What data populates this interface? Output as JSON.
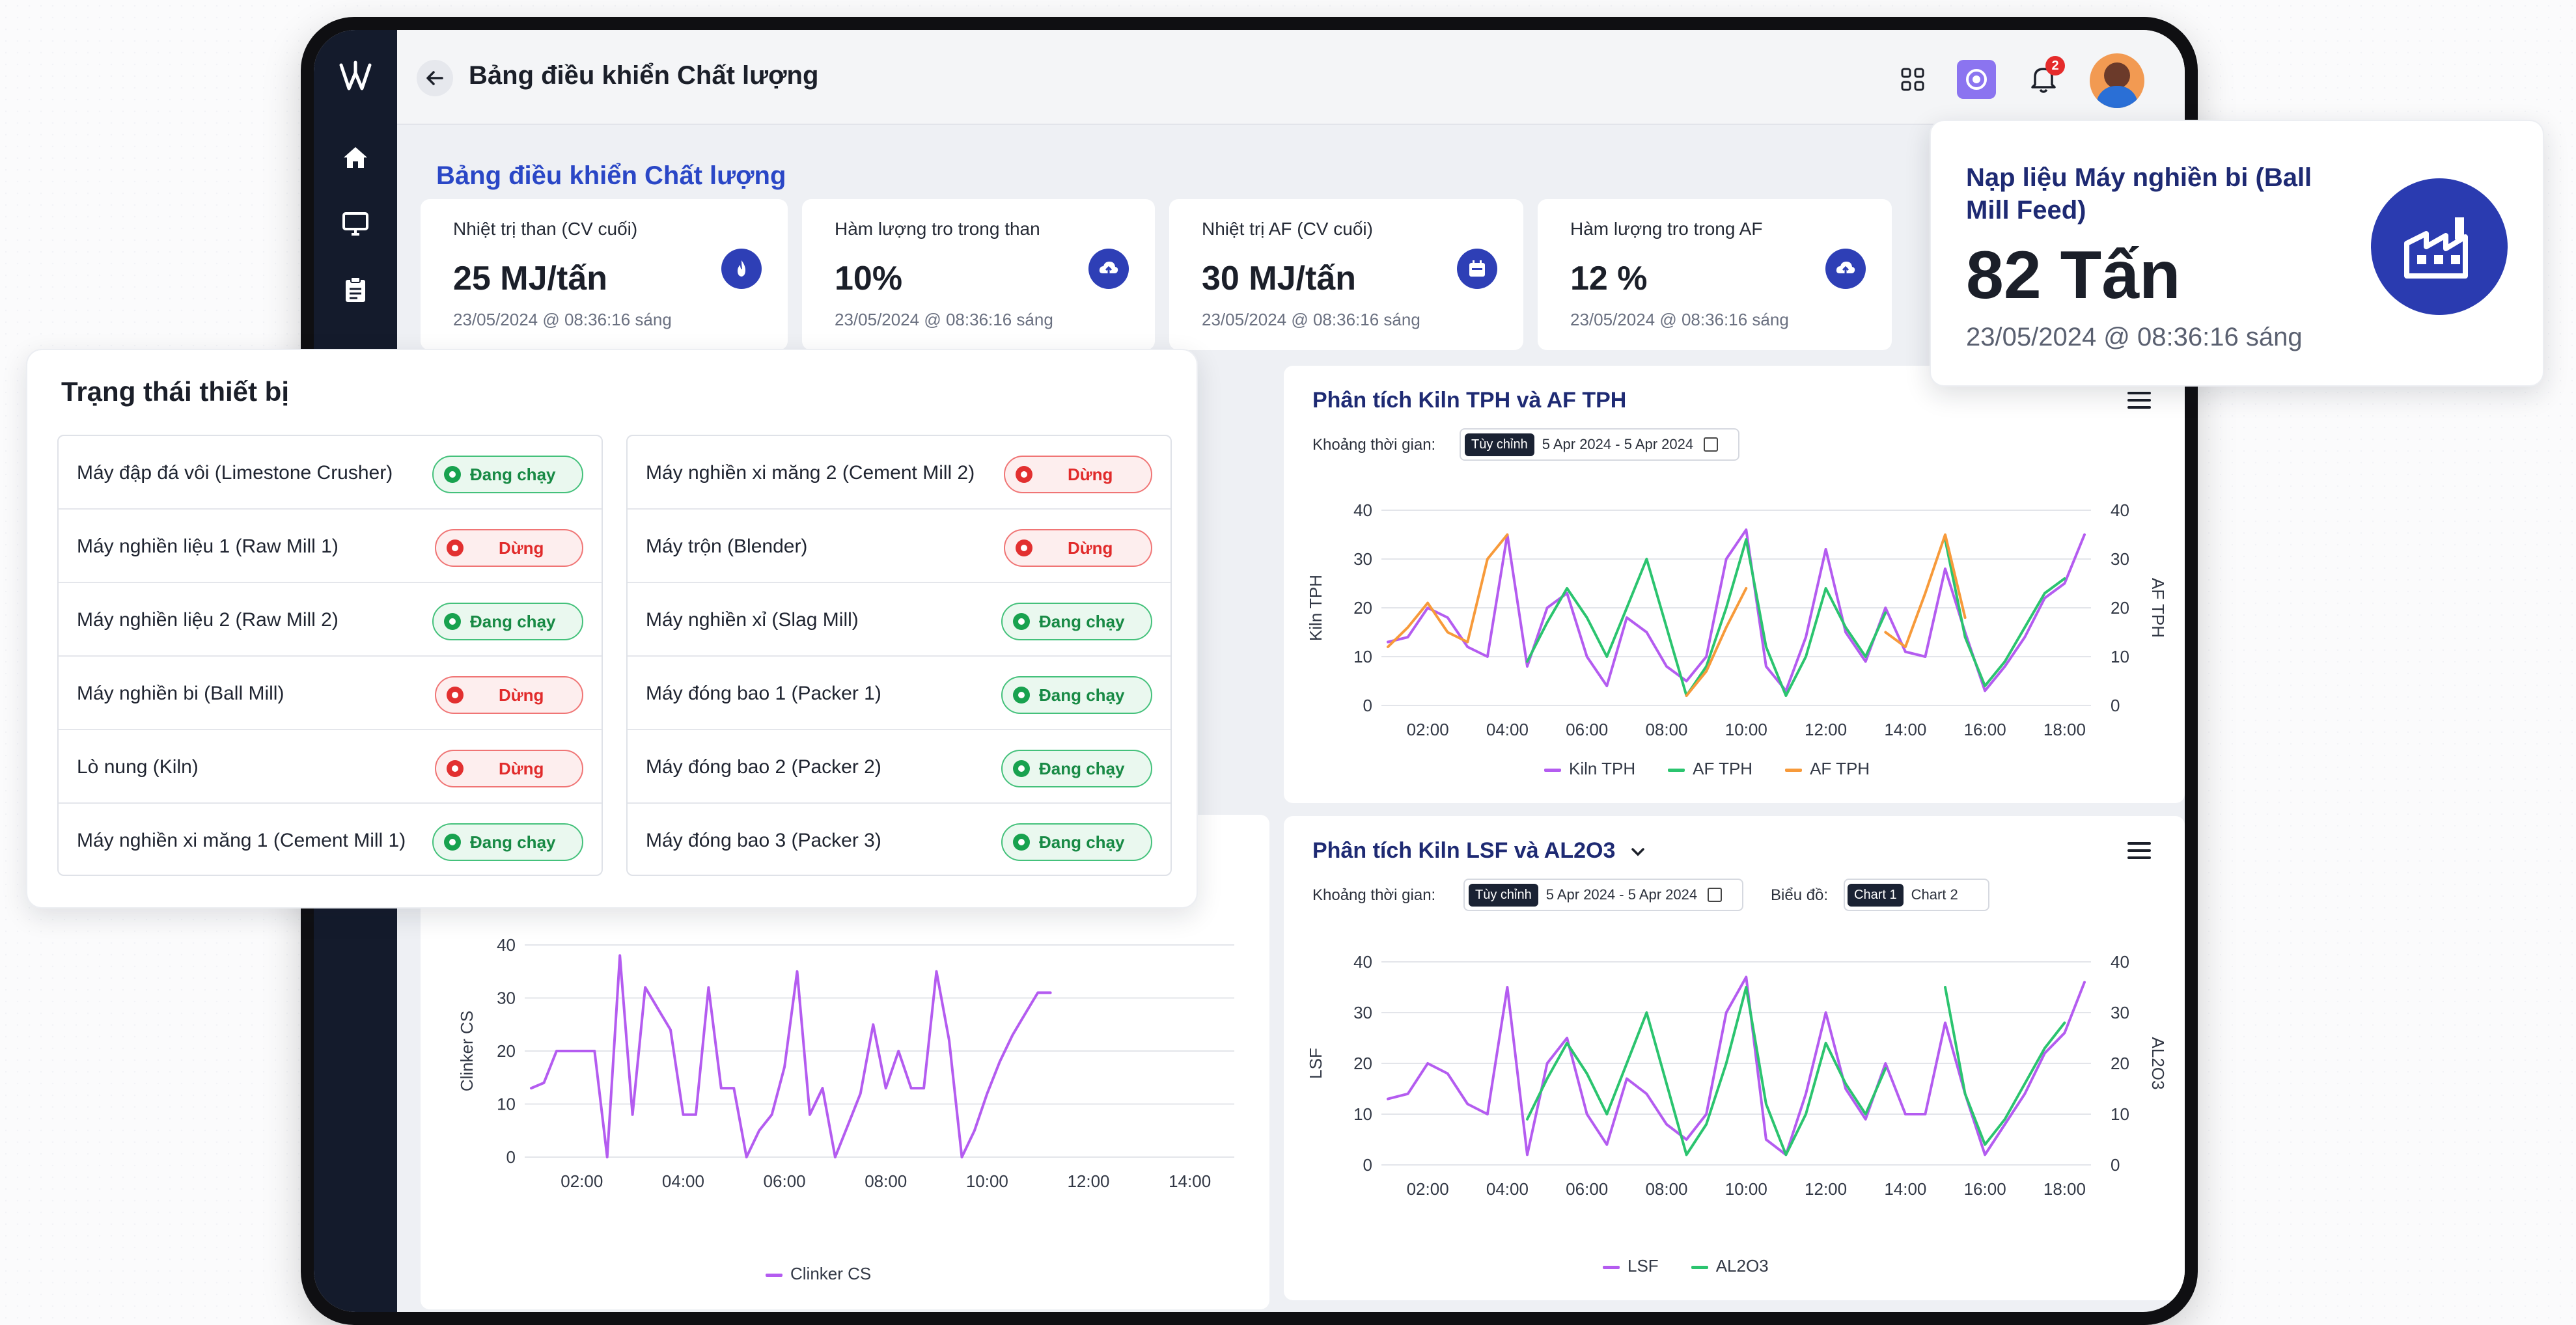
{
  "topbar": {
    "title": "Bảng điều khiển Chất lượng",
    "notification_count": "2"
  },
  "page": {
    "title": "Bảng điều khiển Chất lượng"
  },
  "kpis": [
    {
      "label": "Nhiệt trị than (CV cuối)",
      "value": "25 MJ/tấn",
      "time": "23/05/2024 @ 08:36:16 sáng",
      "icon": "flame-icon"
    },
    {
      "label": "Hàm lượng tro trong than",
      "value": "10%",
      "time": "23/05/2024 @ 08:36:16 sáng",
      "icon": "cloud-upload-icon"
    },
    {
      "label": "Nhiệt trị AF (CV cuối)",
      "value": "30 MJ/tấn",
      "time": "23/05/2024 @ 08:36:16 sáng",
      "icon": "calendar-icon"
    },
    {
      "label": "Hàm lượng tro trong AF",
      "value": "12 %",
      "time": "23/05/2024 @ 08:36:16 sáng",
      "icon": "cloud-upload-icon"
    }
  ],
  "feed": {
    "title": "Nạp liệu Máy nghiền bi (Ball Mill Feed)",
    "value": "82 Tấn",
    "time": "23/05/2024 @ 08:36:16 sáng",
    "icon": "factory-icon"
  },
  "status_panel": {
    "title": "Trạng thái thiết bị",
    "left": [
      {
        "name": "Máy đập đá vôi (Limestone Crusher)",
        "status": "Đang chạy",
        "state": "run"
      },
      {
        "name": "Máy nghiền liệu 1 (Raw Mill 1)",
        "status": "Dừng",
        "state": "stop"
      },
      {
        "name": "Máy nghiền liệu 2 (Raw Mill 2)",
        "status": "Đang chạy",
        "state": "run"
      },
      {
        "name": "Máy nghiền bi (Ball Mill)",
        "status": "Dừng",
        "state": "stop"
      },
      {
        "name": "Lò nung (Kiln)",
        "status": "Dừng",
        "state": "stop"
      },
      {
        "name": "Máy nghiền xi măng 1 (Cement Mill 1)",
        "status": "Đang chạy",
        "state": "run"
      }
    ],
    "right": [
      {
        "name": "Máy nghiền xi măng 2 (Cement Mill 2)",
        "status": "Dừng",
        "state": "stop"
      },
      {
        "name": "Máy trộn (Blender)",
        "status": "Dừng",
        "state": "stop"
      },
      {
        "name": "Máy nghiền xỉ (Slag Mill)",
        "status": "Đang chạy",
        "state": "run"
      },
      {
        "name": "Máy đóng bao 1 (Packer 1)",
        "status": "Đang chạy",
        "state": "run"
      },
      {
        "name": "Máy đóng bao 2 (Packer 2)",
        "status": "Đang chạy",
        "state": "run"
      },
      {
        "name": "Máy đóng bao 3 (Packer 3)",
        "status": "Đang chạy",
        "state": "run"
      }
    ]
  },
  "chart_kiln_tph": {
    "title": "Phân tích Kiln TPH và AF TPH",
    "range_label": "Khoảng thời gian:",
    "range_mode": "Tùy chỉnh",
    "range_value": "5 Apr 2024 - 5 Apr 2024"
  },
  "chart_lsf": {
    "title": "Phân tích Kiln LSF và AL2O3",
    "range_label": "Khoảng thời gian:",
    "range_mode": "Tùy chỉnh",
    "range_value": "5 Apr 2024 - 5 Apr 2024",
    "chart_label": "Biểu đồ:",
    "chart_tab_1": "Chart 1",
    "chart_tab_2": "Chart 2"
  },
  "colors": {
    "purple": "#b45cf0",
    "green": "#2bc46f",
    "orange": "#f79a3a",
    "red": "#ef4040",
    "blue": "#3a8be0",
    "brand": "#2e3fb6"
  },
  "chart_data": [
    {
      "type": "line",
      "title": "Phân tích Kiln TPH và AF TPH",
      "x": [
        "01:00",
        "01:30",
        "02:00",
        "02:30",
        "03:00",
        "03:30",
        "04:00",
        "04:30",
        "05:00",
        "05:30",
        "06:00",
        "06:30",
        "07:00",
        "07:30",
        "08:00",
        "08:30",
        "09:00",
        "09:30",
        "10:00",
        "10:30",
        "11:00",
        "11:30",
        "12:00",
        "12:30",
        "13:00",
        "13:30",
        "14:00",
        "14:30",
        "15:00",
        "15:30",
        "16:00",
        "16:30",
        "17:00",
        "17:30",
        "18:00",
        "18:30"
      ],
      "series": [
        {
          "name": "Kiln TPH",
          "color": "#b45cf0",
          "values": [
            13,
            14,
            20,
            18,
            12,
            10,
            35,
            8,
            20,
            23,
            10,
            4,
            18,
            15,
            8,
            5,
            10,
            30,
            36,
            8,
            3,
            14,
            32,
            15,
            9,
            20,
            11,
            10,
            28,
            15,
            3,
            8,
            14,
            22,
            25,
            35
          ]
        },
        {
          "name": "AF TPH",
          "color": "#2bc46f",
          "values": [
            null,
            null,
            null,
            null,
            null,
            null,
            null,
            9,
            17,
            24,
            18,
            10,
            20,
            30,
            16,
            2,
            8,
            20,
            34,
            12,
            2,
            10,
            24,
            16,
            10,
            19,
            null,
            null,
            34,
            14,
            4,
            9,
            16,
            23,
            26,
            null
          ]
        },
        {
          "name": "AF TPH",
          "color": "#f79a3a",
          "values": [
            12,
            16,
            21,
            15,
            13,
            30,
            35,
            null,
            null,
            null,
            null,
            null,
            null,
            null,
            null,
            2,
            7,
            16,
            24,
            null,
            null,
            null,
            null,
            null,
            null,
            15,
            12,
            23,
            35,
            18,
            null,
            null,
            null,
            null,
            null,
            null
          ]
        }
      ],
      "ylabel": "Kiln TPH",
      "y2label": "AF TPH",
      "ylim": [
        0,
        40
      ],
      "y2lim": [
        0,
        40
      ],
      "xticks": [
        "02:00",
        "04:00",
        "06:00",
        "08:00",
        "10:00",
        "12:00",
        "14:00",
        "16:00",
        "18:00"
      ],
      "yticks": [
        0,
        10,
        20,
        30,
        40
      ],
      "legend": "bottom"
    },
    {
      "type": "line",
      "title": "Phân tích Kiln LSF và AL2O3",
      "x": [
        "01:00",
        "01:30",
        "02:00",
        "02:30",
        "03:00",
        "03:30",
        "04:00",
        "04:30",
        "05:00",
        "05:30",
        "06:00",
        "06:30",
        "07:00",
        "07:30",
        "08:00",
        "08:30",
        "09:00",
        "09:30",
        "10:00",
        "10:30",
        "11:00",
        "11:30",
        "12:00",
        "12:30",
        "13:00",
        "13:30",
        "14:00",
        "14:30",
        "15:00",
        "15:30",
        "16:00",
        "16:30",
        "17:00",
        "17:30",
        "18:00",
        "18:30"
      ],
      "series": [
        {
          "name": "LSF",
          "color": "#b45cf0",
          "values": [
            13,
            14,
            20,
            18,
            12,
            10,
            35,
            2,
            20,
            25,
            10,
            4,
            17,
            14,
            8,
            5,
            10,
            30,
            37,
            5,
            2,
            14,
            30,
            15,
            9,
            20,
            10,
            10,
            28,
            14,
            2,
            8,
            14,
            22,
            26,
            36
          ]
        },
        {
          "name": "AL2O3",
          "color": "#2bc46f",
          "values": [
            null,
            null,
            null,
            null,
            null,
            null,
            null,
            9,
            17,
            24,
            18,
            10,
            20,
            30,
            16,
            2,
            8,
            20,
            35,
            12,
            2,
            10,
            24,
            16,
            10,
            19,
            null,
            null,
            35,
            14,
            4,
            9,
            16,
            23,
            28,
            null
          ]
        }
      ],
      "ylabel": "LSF",
      "y2label": "AL2O3",
      "ylim": [
        0,
        40
      ],
      "y2lim": [
        0,
        40
      ],
      "xticks": [
        "02:00",
        "04:00",
        "06:00",
        "08:00",
        "10:00",
        "12:00",
        "14:00",
        "16:00",
        "18:00"
      ],
      "yticks": [
        0,
        10,
        20,
        30,
        40
      ],
      "legend": "bottom"
    },
    {
      "type": "line",
      "title": "",
      "x": [
        "01:00",
        "01:15",
        "01:30",
        "01:45",
        "02:00",
        "02:15",
        "02:30",
        "02:45",
        "03:00",
        "03:15",
        "03:30",
        "03:45",
        "04:00",
        "04:15",
        "04:30",
        "04:45",
        "05:00",
        "05:15",
        "05:30",
        "05:45",
        "06:00",
        "06:15",
        "06:30",
        "06:45",
        "07:00",
        "07:15",
        "07:30",
        "07:45",
        "08:00",
        "08:15",
        "08:30",
        "08:45",
        "09:00",
        "09:15",
        "09:30",
        "09:45",
        "10:00",
        "10:15",
        "10:30",
        "10:45",
        "11:00",
        "11:15",
        "11:30",
        "11:45",
        "12:00",
        "12:15",
        "12:30",
        "12:45",
        "13:00",
        "13:15",
        "13:30",
        "13:45",
        "14:00",
        "14:15",
        "14:30",
        "14:45"
      ],
      "series": [
        {
          "name": "Clinker CS",
          "color": "#b45cf0",
          "values": [
            13,
            14,
            20,
            20,
            20,
            20,
            0,
            38,
            8,
            32,
            28,
            24,
            8,
            8,
            32,
            13,
            13,
            0,
            5,
            8,
            17,
            35,
            8,
            13,
            0,
            6,
            12,
            25,
            13,
            20,
            13,
            13,
            35,
            22,
            0,
            5,
            12,
            18,
            23,
            27,
            31,
            31
          ]
        }
      ],
      "ylabel": "Clinker CS",
      "ylim": [
        0,
        40
      ],
      "xticks": [
        "02:00",
        "04:00",
        "06:00",
        "08:00",
        "10:00",
        "12:00",
        "14:00"
      ],
      "yticks": [
        0,
        10,
        20,
        30,
        40
      ],
      "legend": "bottom"
    }
  ]
}
